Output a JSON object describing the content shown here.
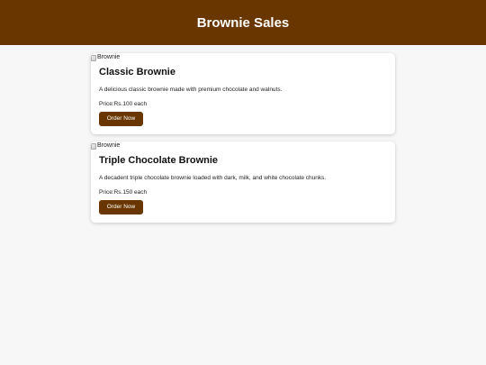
{
  "header": {
    "title": "Brownie Sales"
  },
  "products": [
    {
      "image_alt": "Brownie",
      "name": "Classic Brownie",
      "description": "A delicious classic brownie made with premium chocolate and walnuts.",
      "price": "Price:Rs.100 each",
      "button_label": "Order Now"
    },
    {
      "image_alt": "Brownie",
      "name": "Triple Chocolate Brownie",
      "description": "A decadent triple chocolate brownie loaded with dark, milk, and white chocolate chunks.",
      "price": "Price:Rs.150 each",
      "button_label": "Order Now"
    }
  ],
  "colors": {
    "brand": "#693600",
    "background": "#f7f7f7",
    "card": "#ffffff"
  }
}
